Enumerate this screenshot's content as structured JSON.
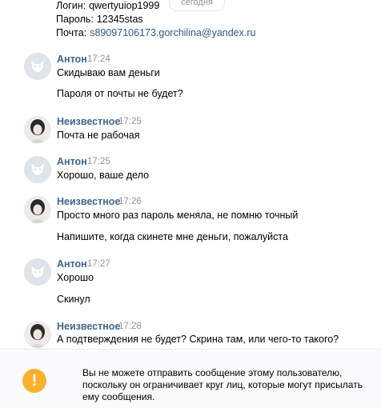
{
  "credentials": {
    "login_label": "Логин:",
    "login_value": "qwertyuiop1999",
    "password_label": "Пароль:",
    "password_value": "12345stas",
    "email_label": "Почта:",
    "email_value": "s89097106173.gorchilina@yandex.ru"
  },
  "date_divider": "сегодня",
  "messages": [
    {
      "sender": "Антон",
      "time": "17:24",
      "lines": [
        "Скидываю вам деньги",
        "Пароля от почты не будет?"
      ]
    },
    {
      "sender": "Неизвестное",
      "time": "17:25",
      "lines": [
        "Почта не рабочая"
      ]
    },
    {
      "sender": "Антон",
      "time": "17:25",
      "lines": [
        "Хорошо, ваше дело"
      ]
    },
    {
      "sender": "Неизвестное",
      "time": "17:26",
      "lines": [
        "Просто много раз пароль меняла, не помню точный",
        "Напишите, когда скинете мне деньги, пожалуйста"
      ]
    },
    {
      "sender": "Антон",
      "time": "17:27",
      "lines": [
        "Хорошо",
        "Скинул"
      ]
    },
    {
      "sender": "Неизвестное",
      "time": "17:28",
      "lines": [
        "А подтверждения не будет? Скрина там, или чего-то такого?"
      ]
    }
  ],
  "footer": {
    "warning_symbol": "!",
    "notice": "Вы не можете отправить сообщение этому пользователю, поскольку он ограничивает круг лиц, которые могут присылать ему сообщения."
  },
  "colors": {
    "name": "#42648b",
    "link": "#2a5885",
    "time": "#939393",
    "warning": "#fcb02e"
  }
}
